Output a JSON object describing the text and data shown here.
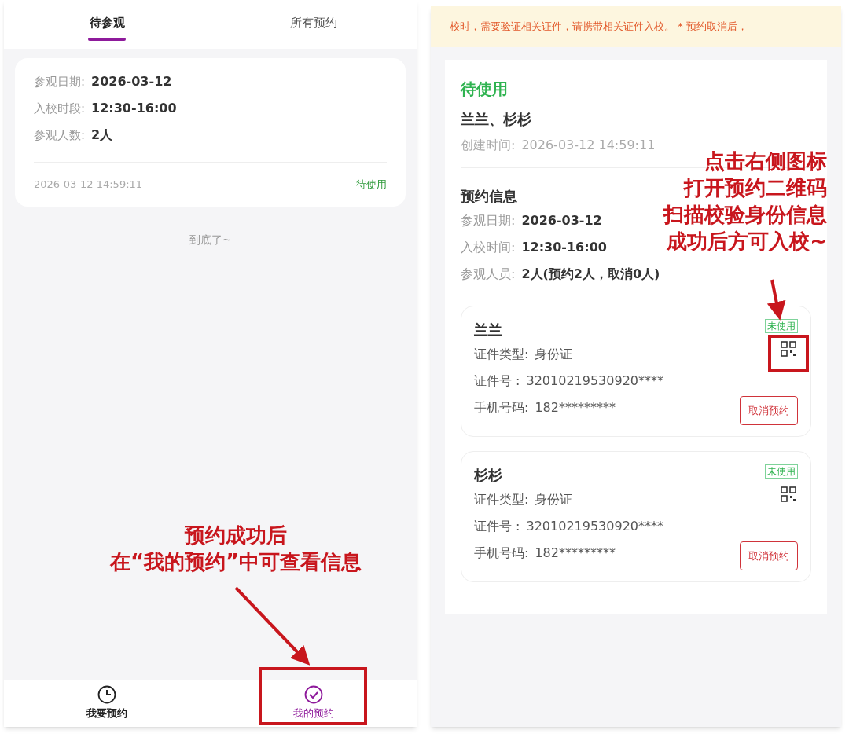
{
  "left": {
    "tabs": [
      {
        "label": "待参观",
        "selected": true
      },
      {
        "label": "所有预约",
        "selected": false
      }
    ],
    "booking": {
      "fields": [
        {
          "label": "参观日期:",
          "value": "2026-03-12"
        },
        {
          "label": "入校时段:",
          "value": "12:30-16:00"
        },
        {
          "label": "参观人数:",
          "value": "2人"
        }
      ],
      "created": "2026-03-12 14:59:11",
      "status": "待使用"
    },
    "end_text": "到底了~",
    "nav": [
      {
        "label": "我要预约",
        "kind": "clock",
        "selected": false
      },
      {
        "label": "我的预约",
        "kind": "check",
        "selected": true
      }
    ]
  },
  "right": {
    "notice": "校时，需要验证相关证件，请携带相关证件入校。 * 预约取消后，",
    "status": "待使用",
    "names": "兰兰、杉杉",
    "created": {
      "label": "创建时间:",
      "value": "2026-03-12 14:59:11"
    },
    "section_title": "预约信息",
    "fields": [
      {
        "label": "参观日期:",
        "value": "2026-03-12"
      },
      {
        "label": "入校时间:",
        "value": "12:30-16:00"
      },
      {
        "label": "参观人员:",
        "value": "2人(预约2人，取消0人)"
      }
    ],
    "visitors": [
      {
        "name": "兰兰",
        "badge": "未使用",
        "fields": [
          {
            "label": "证件类型:",
            "value": "身份证"
          },
          {
            "label": "证件号 :",
            "value": "32010219530920****"
          },
          {
            "label": "手机号码:",
            "value": "182*********"
          }
        ],
        "button": "取消预约"
      },
      {
        "name": "杉杉",
        "badge": "未使用",
        "fields": [
          {
            "label": "证件类型:",
            "value": "身份证"
          },
          {
            "label": "证件号 :",
            "value": "32010219530920****"
          },
          {
            "label": "手机号码:",
            "value": "182*********"
          }
        ],
        "button": "取消预约"
      }
    ]
  },
  "annotations": [
    {
      "lines": [
        "预约成功后",
        "在“我的预约”中可查看信息"
      ]
    },
    {
      "lines": [
        "点击右侧图标",
        "打开预约二维码",
        "扫描校验身份信息",
        "成功后方可入校~"
      ]
    }
  ]
}
